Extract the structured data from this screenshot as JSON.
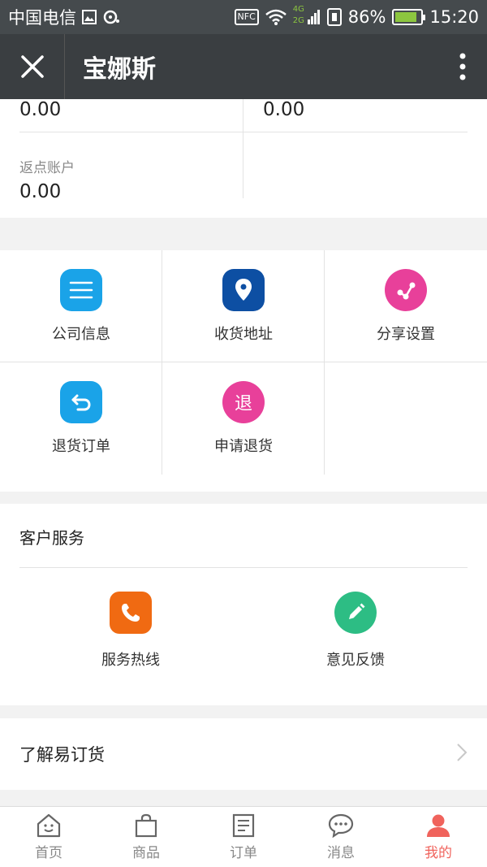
{
  "status_bar": {
    "carrier": "中国电信",
    "battery_percent": "86%",
    "time": "15:20",
    "nfc": "NFC",
    "network_4g": "4G",
    "network_2g": "2G",
    "battery_level": 0.86
  },
  "app_bar": {
    "title": "宝娜斯",
    "close_icon": "close-icon",
    "more_icon": "more-vertical-icon"
  },
  "accounts": {
    "top_left_value": "0.00",
    "top_right_value": "0.00",
    "rebate_label": "返点账户",
    "rebate_value": "0.00"
  },
  "grid": {
    "items": [
      {
        "label": "公司信息",
        "icon": "menu-lines-icon",
        "color": "#1aa3e8"
      },
      {
        "label": "收货地址",
        "icon": "location-pin-icon",
        "color": "#0d4fa3"
      },
      {
        "label": "分享设置",
        "icon": "share-icon",
        "color": "#e8409a"
      },
      {
        "label": "退货订单",
        "icon": "return-arrow-icon",
        "color": "#1aa3e8"
      },
      {
        "label": "申请退货",
        "icon": "return-text-icon",
        "icon_text": "退",
        "color": "#e8409a"
      }
    ]
  },
  "service": {
    "title": "客户服务",
    "items": [
      {
        "label": "服务热线",
        "icon": "phone-icon",
        "color": "#f06a12"
      },
      {
        "label": "意见反馈",
        "icon": "pencil-icon",
        "color": "#2dbd84"
      }
    ]
  },
  "learn": {
    "label": "了解易订货"
  },
  "tabbar": {
    "tabs": [
      {
        "label": "首页",
        "icon": "home-icon"
      },
      {
        "label": "商品",
        "icon": "shopping-bag-icon"
      },
      {
        "label": "订单",
        "icon": "order-list-icon"
      },
      {
        "label": "消息",
        "icon": "message-icon"
      },
      {
        "label": "我的",
        "icon": "user-icon"
      }
    ],
    "active_color": "#f0635c"
  }
}
